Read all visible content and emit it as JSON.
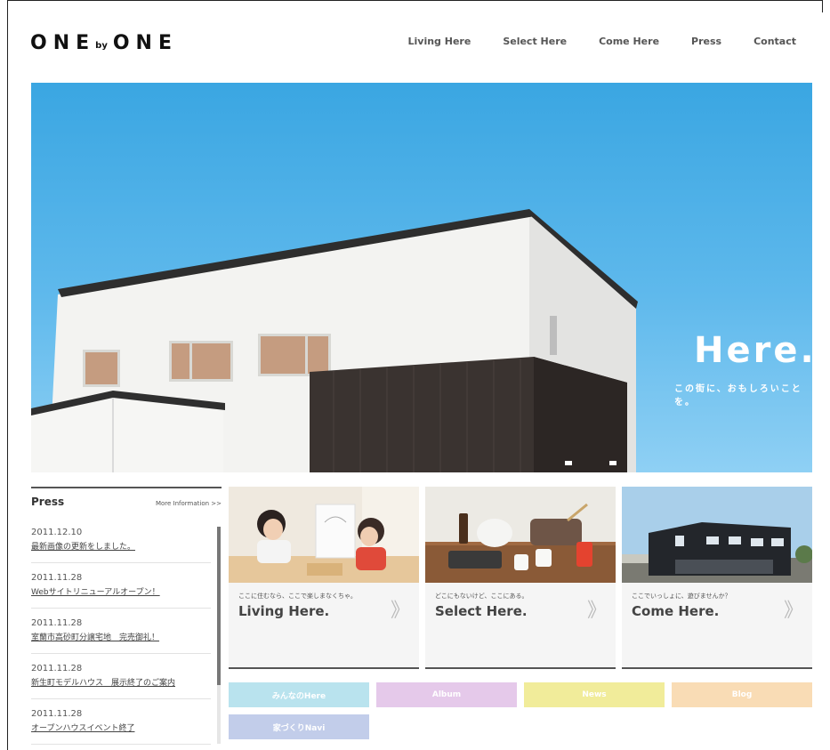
{
  "header": {
    "logo_left": "ONE",
    "logo_by": "by",
    "logo_right": "ONE",
    "nav": [
      "Living Here",
      "Select Here",
      "Come Here",
      "Press",
      "Contact"
    ]
  },
  "hero": {
    "title": "Here.",
    "subtitle": "この街に、おもしろいことを。"
  },
  "press": {
    "title": "Press",
    "more": "More Information >>",
    "items": [
      {
        "date": "2011.12.10",
        "text": "最新画像の更新をしました。"
      },
      {
        "date": "2011.11.28",
        "text": "Webサイトリニューアルオープン！"
      },
      {
        "date": "2011.11.28",
        "text": "室蘭市高砂町分譲宅地　完売御礼！"
      },
      {
        "date": "2011.11.28",
        "text": "新生町モデルハウス　展示終了のご案内"
      },
      {
        "date": "2011.11.28",
        "text": "オープンハウスイベント終了"
      }
    ]
  },
  "cards": [
    {
      "caption": "ここに住むなら、ここで楽しまなくちゃ。",
      "title": "Living Here.",
      "chevron": "》"
    },
    {
      "caption": "どこにもないけど、ここにある。",
      "title": "Select Here.",
      "chevron": "》"
    },
    {
      "caption": "ここでいっしょに、遊びませんか？",
      "title": "Come Here.",
      "chevron": "》"
    }
  ],
  "tags": [
    {
      "label": "みんなのHere",
      "color": "#b9e3ee"
    },
    {
      "label": "Album",
      "color": "#e5c9ea"
    },
    {
      "label": "News",
      "color": "#f1ec9a"
    },
    {
      "label": "Blog",
      "color": "#f9dcb5"
    },
    {
      "label": "家づくりNavi",
      "color": "#c2cdea"
    }
  ],
  "colors": {
    "sky": "#4daee6",
    "wall": "#f4f4f2",
    "dark_wood": "#3a3330"
  }
}
